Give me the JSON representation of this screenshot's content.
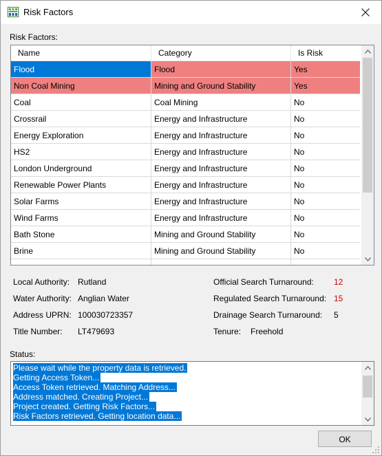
{
  "window": {
    "title": "Risk Factors"
  },
  "risk_section": {
    "label": "Risk Factors:"
  },
  "grid": {
    "headers": [
      "Name",
      "Category",
      "Is Risk"
    ],
    "rows": [
      {
        "name": "Flood",
        "category": "Flood",
        "is_risk": "Yes"
      },
      {
        "name": "Non Coal Mining",
        "category": "Mining and Ground Stability",
        "is_risk": "Yes"
      },
      {
        "name": "Coal",
        "category": "Coal Mining",
        "is_risk": "No"
      },
      {
        "name": "Crossrail",
        "category": "Energy and Infrastructure",
        "is_risk": "No"
      },
      {
        "name": "Energy Exploration",
        "category": "Energy and Infrastructure",
        "is_risk": "No"
      },
      {
        "name": "HS2",
        "category": "Energy and Infrastructure",
        "is_risk": "No"
      },
      {
        "name": "London Underground",
        "category": "Energy and Infrastructure",
        "is_risk": "No"
      },
      {
        "name": "Renewable Power Plants",
        "category": "Energy and Infrastructure",
        "is_risk": "No"
      },
      {
        "name": "Solar Farms",
        "category": "Energy and Infrastructure",
        "is_risk": "No"
      },
      {
        "name": "Wind Farms",
        "category": "Energy and Infrastructure",
        "is_risk": "No"
      },
      {
        "name": "Bath Stone",
        "category": "Mining and Ground Stability",
        "is_risk": "No"
      },
      {
        "name": "Brine",
        "category": "Mining and Ground Stability",
        "is_risk": "No"
      }
    ],
    "highlight_color": "#f08080",
    "selection_color": "#0078d7"
  },
  "details": {
    "local_authority_label": "Local Authority:",
    "local_authority": "Rutland",
    "water_authority_label": "Water Authority:",
    "water_authority": "Anglian Water",
    "uprn_label": "Address UPRN:",
    "uprn": "100030723357",
    "title_number_label": "Title Number:",
    "title_number": "LT479693",
    "official_label": "Official Search Turnaround:",
    "official": "12",
    "regulated_label": "Regulated Search Turnaround:",
    "regulated": "15",
    "drainage_label": "Drainage Search Turnaround:",
    "drainage": "5",
    "tenure_label": "Tenure:",
    "tenure": "Freehold"
  },
  "status": {
    "label": "Status:",
    "lines": [
      "Please wait while the property data is retrieved.",
      "Getting Access Token...",
      "Access Token retrieved. Matching Address...",
      "Address matched. Creating Project...",
      "Project created. Getting Risk Factors...",
      "Risk Factors retrieved. Getting location data..."
    ]
  },
  "buttons": {
    "ok": "OK"
  },
  "icons": {
    "app": "app-grid-icon",
    "close": "close-icon"
  }
}
